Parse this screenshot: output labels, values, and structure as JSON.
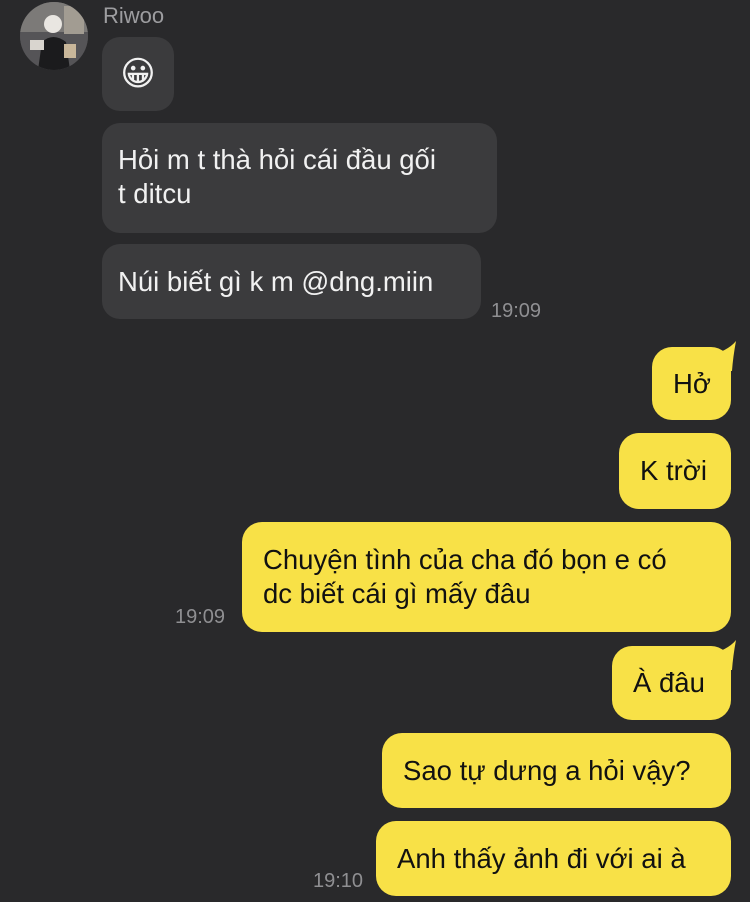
{
  "chat": {
    "sender": "Riwoo",
    "incoming": [
      {
        "text": "😀"
      },
      {
        "lines": [
          "Hỏi m t thà hỏi cái đầu gối",
          "t ditcu"
        ]
      },
      {
        "text": "Núi biết gì k m @dng.miin"
      }
    ],
    "incoming_time": "19:09",
    "outgoing": [
      {
        "text": "Hở"
      },
      {
        "text": "K trời"
      },
      {
        "lines": [
          "Chuyện tình của cha đó bọn e có",
          "dc biết cái gì mấy đâu"
        ],
        "time": "19:09"
      },
      {
        "text": "À đâu"
      },
      {
        "text": "Sao tự dưng a hỏi vậy?"
      },
      {
        "text": "Anh thấy ảnh đi với ai à",
        "time": "19:10"
      }
    ]
  },
  "colors": {
    "background": "#29292b",
    "incoming_bubble": "#3b3b3d",
    "outgoing_bubble": "#f8e147",
    "timestamp": "#8f8f92"
  },
  "icons": {
    "avatar": "profile-photo"
  }
}
